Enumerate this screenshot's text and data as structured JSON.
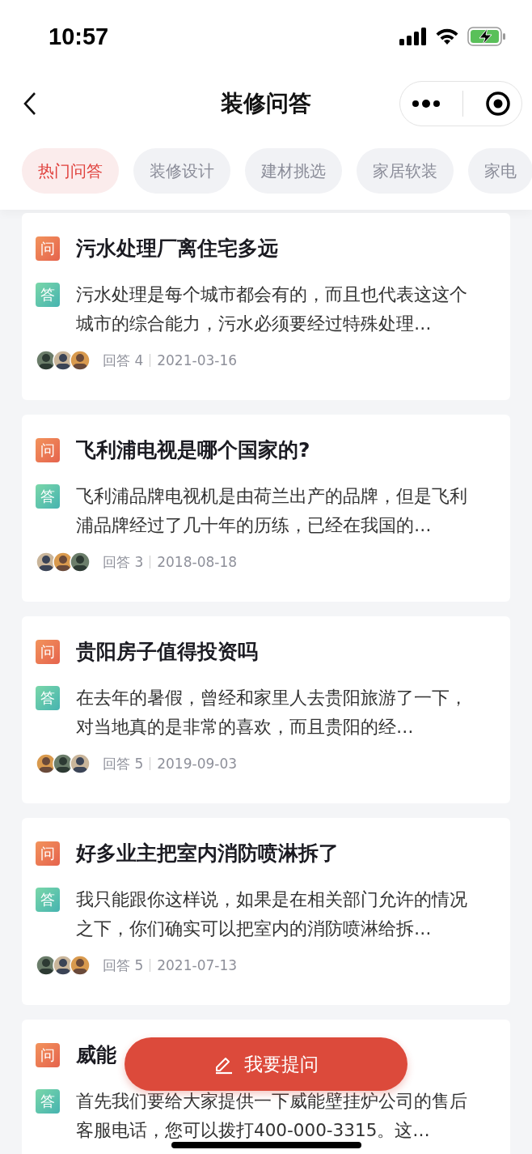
{
  "status_bar": {
    "time": "10:57"
  },
  "nav": {
    "title": "装修问答"
  },
  "tabs": [
    {
      "label": "热门问答",
      "selected": true
    },
    {
      "label": "装修设计",
      "selected": false
    },
    {
      "label": "建材挑选",
      "selected": false
    },
    {
      "label": "家居软装",
      "selected": false
    },
    {
      "label": "家电",
      "selected": false
    }
  ],
  "questions": [
    {
      "badge_q": "问",
      "title": "污水处理厂离住宅多远",
      "badge_a": "答",
      "answer": "污水处理是每个城市都会有的，而且也代表这这个城市的综合能力，污水必须要经过特殊处理…",
      "answers": "回答 4",
      "date": "2021-03-16"
    },
    {
      "badge_q": "问",
      "title": "飞利浦电视是哪个国家的?",
      "badge_a": "答",
      "answer": "飞利浦品牌电视机是由荷兰出产的品牌，但是飞利浦品牌经过了几十年的历练，已经在我国的…",
      "answers": "回答 3",
      "date": "2018-08-18"
    },
    {
      "badge_q": "问",
      "title": "贵阳房子值得投资吗",
      "badge_a": "答",
      "answer": "在去年的暑假，曾经和家里人去贵阳旅游了一下，对当地真的是非常的喜欢，而且贵阳的经…",
      "answers": "回答 5",
      "date": "2019-09-03"
    },
    {
      "badge_q": "问",
      "title": "好多业主把室内消防喷淋拆了",
      "badge_a": "答",
      "answer": "我只能跟你这样说，如果是在相关部门允许的情况之下，你们确实可以把室内的消防喷淋给拆…",
      "answers": "回答 5",
      "date": "2021-07-13"
    },
    {
      "badge_q": "问",
      "title": "威能",
      "badge_a": "答",
      "answer": "首先我们要给大家提供一下威能壁挂炉公司的售后客服电话，您可以拨打400-000-3315。这…"
    }
  ],
  "fab": {
    "label": "我要提问"
  }
}
